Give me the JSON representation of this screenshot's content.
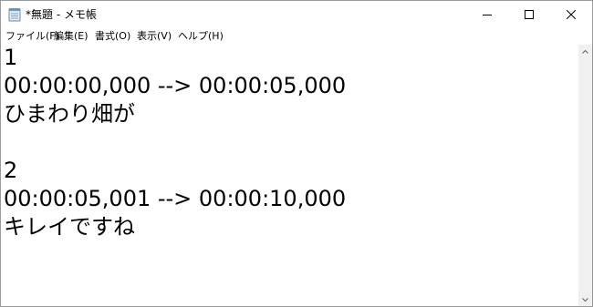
{
  "window": {
    "title": "*無題 - メモ帳",
    "icon": "notepad-icon"
  },
  "controls": {
    "minimize_icon": "minimize-icon",
    "maximize_icon": "maximize-icon",
    "close_icon": "close-icon"
  },
  "menu": {
    "items": [
      {
        "label": "ファイル(F)"
      },
      {
        "label": "編集(E)"
      },
      {
        "label": "書式(O)"
      },
      {
        "label": "表示(V)"
      },
      {
        "label": "ヘルプ(H)"
      }
    ]
  },
  "editor": {
    "lines": [
      "1",
      "00:00:00,000 --> 00:00:05,000",
      "ひまわり畑が",
      "",
      "2",
      "00:00:05,001 --> 00:00:10,000",
      "キレイですね"
    ]
  },
  "scrollbar": {
    "up_icon": "scroll-up-arrow-icon",
    "down_icon": "scroll-down-arrow-icon"
  },
  "colors": {
    "background": "#ffffff",
    "scrollbar_track": "#f0f0f0",
    "border": "#9a9a9a",
    "text": "#000000"
  }
}
